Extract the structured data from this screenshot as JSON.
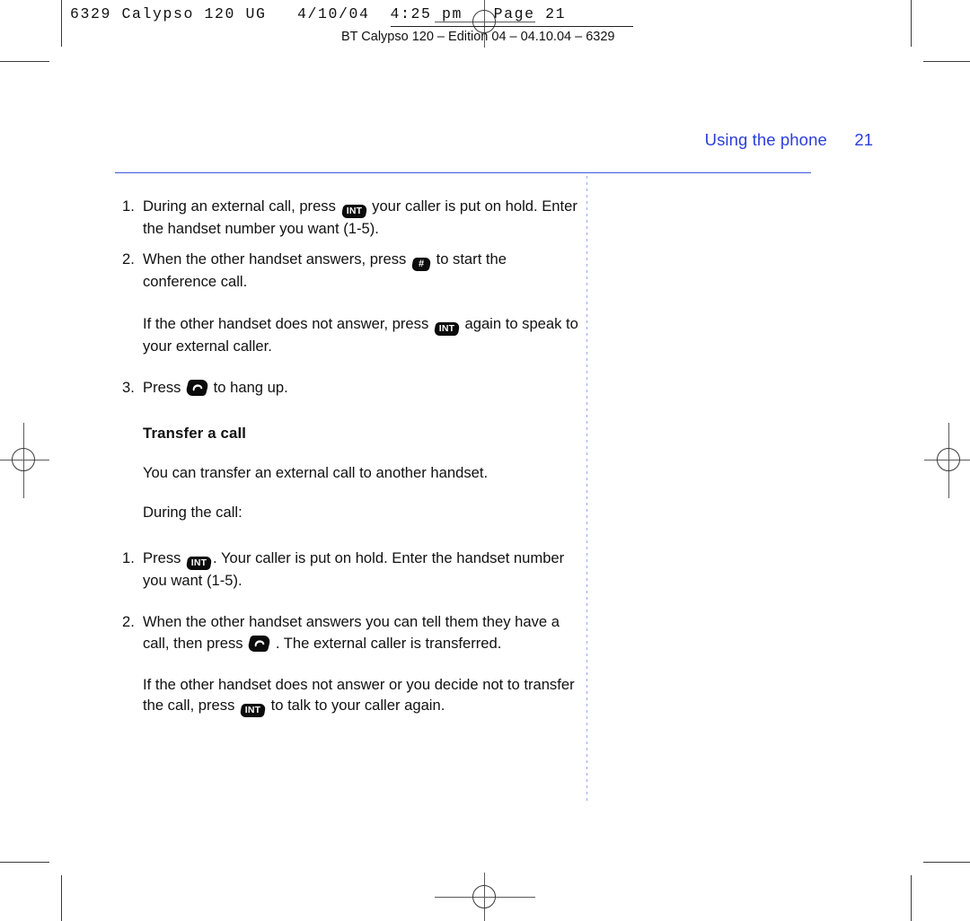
{
  "slug": {
    "mono_line": "6329 Calypso 120 UG   4/10/04  4:25 pm   Page 21",
    "sub_line": "BT Calypso 120 – Edition 04 – 04.10.04 – 6329"
  },
  "running_head": {
    "title": "Using the phone",
    "page_number": "21"
  },
  "colors": {
    "accent_blue": "#2b3ddd",
    "rule_blue": "#3d5ae0",
    "dotted_guide": "#9aa7f0",
    "key_black": "#0b0b0b",
    "body_text": "#111111"
  },
  "keys": {
    "int_label": "INT",
    "hash_label": "#",
    "end_call_label": "hang-up"
  },
  "content": {
    "conference_steps": [
      {
        "number": "1.",
        "text_before": "During an external call, press",
        "key": "INT",
        "text_after": "your caller is put on hold. Enter the handset number you want (1-5)."
      },
      {
        "number": "2.",
        "text_before": "When the other handset answers, press",
        "key": "#",
        "text_after": "to start the conference call."
      }
    ],
    "conference_note": {
      "text_before": "If the other handset does not answer, press",
      "key": "INT",
      "text_after": "again to speak to your external caller."
    },
    "hang_up_step": {
      "number": "3.",
      "text_before": "Press",
      "key": "hang-up",
      "text_after": "to hang up."
    },
    "section_heading": "Transfer a call",
    "section_intro": "You can transfer an external call to another handset.",
    "section_lead": "During the call:",
    "transfer_steps": [
      {
        "number": "1.",
        "text_before": "Press",
        "key": "INT",
        "text_after": ". Your caller is put on hold. Enter the handset number you want (1-5)."
      },
      {
        "number": "2.",
        "text_before": "When the other handset answers you can tell them they have a call, then press",
        "key": "hang-up",
        "text_after": ". The external caller is transferred."
      }
    ],
    "transfer_note": {
      "text_before": "If the other handset does not answer or you decide not to transfer the call, press",
      "key": "INT",
      "text_after": "to talk to your caller again."
    }
  }
}
